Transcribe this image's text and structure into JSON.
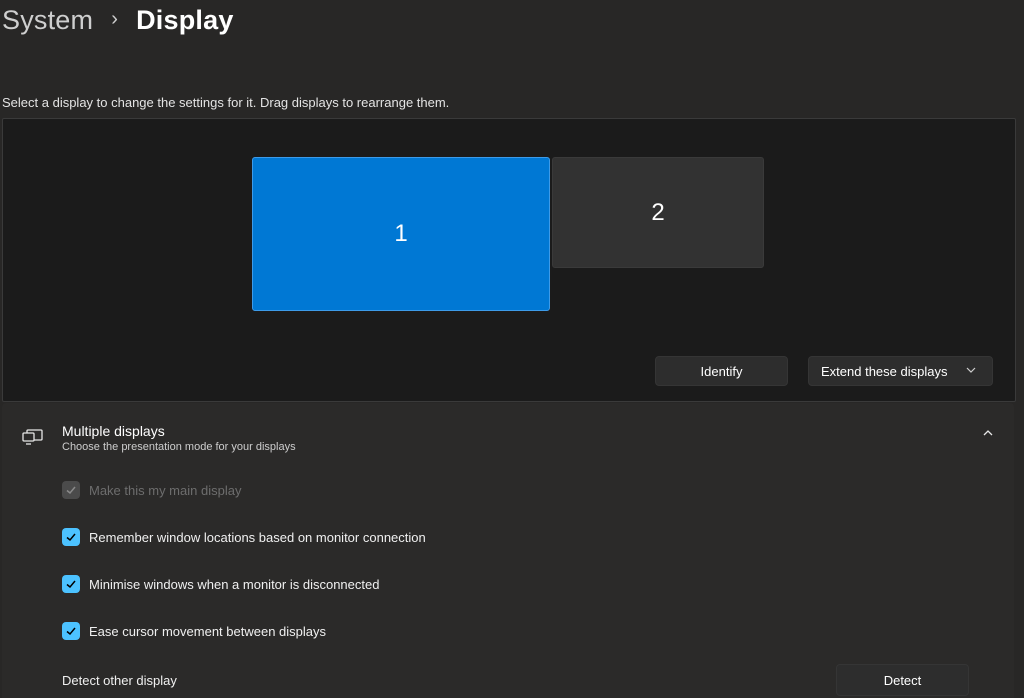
{
  "breadcrumb": {
    "parent": "System",
    "separator": "›",
    "current": "Display"
  },
  "instruction": "Select a display to change the settings for it. Drag displays to rearrange them.",
  "monitors": [
    {
      "label": "1",
      "selected": true
    },
    {
      "label": "2",
      "selected": false
    }
  ],
  "arrangement_buttons": {
    "identify": "Identify",
    "mode": "Extend these displays"
  },
  "multiple_displays": {
    "title": "Multiple displays",
    "subtitle": "Choose the presentation mode for your displays",
    "expanded": true,
    "options": [
      {
        "label": "Make this my main display",
        "checked": true,
        "disabled": true
      },
      {
        "label": "Remember window locations based on monitor connection",
        "checked": true,
        "disabled": false
      },
      {
        "label": "Minimise windows when a monitor is disconnected",
        "checked": true,
        "disabled": false
      },
      {
        "label": "Ease cursor movement between displays",
        "checked": true,
        "disabled": false
      }
    ],
    "detect_label": "Detect other display",
    "detect_button": "Detect"
  },
  "colors": {
    "accent": "#0078d4",
    "checkbox": "#4cc2ff",
    "background": "#282726"
  },
  "icons": {
    "section": "multiple-displays-icon",
    "collapse": "chevron-up-icon",
    "dropdown": "chevron-down-icon"
  }
}
